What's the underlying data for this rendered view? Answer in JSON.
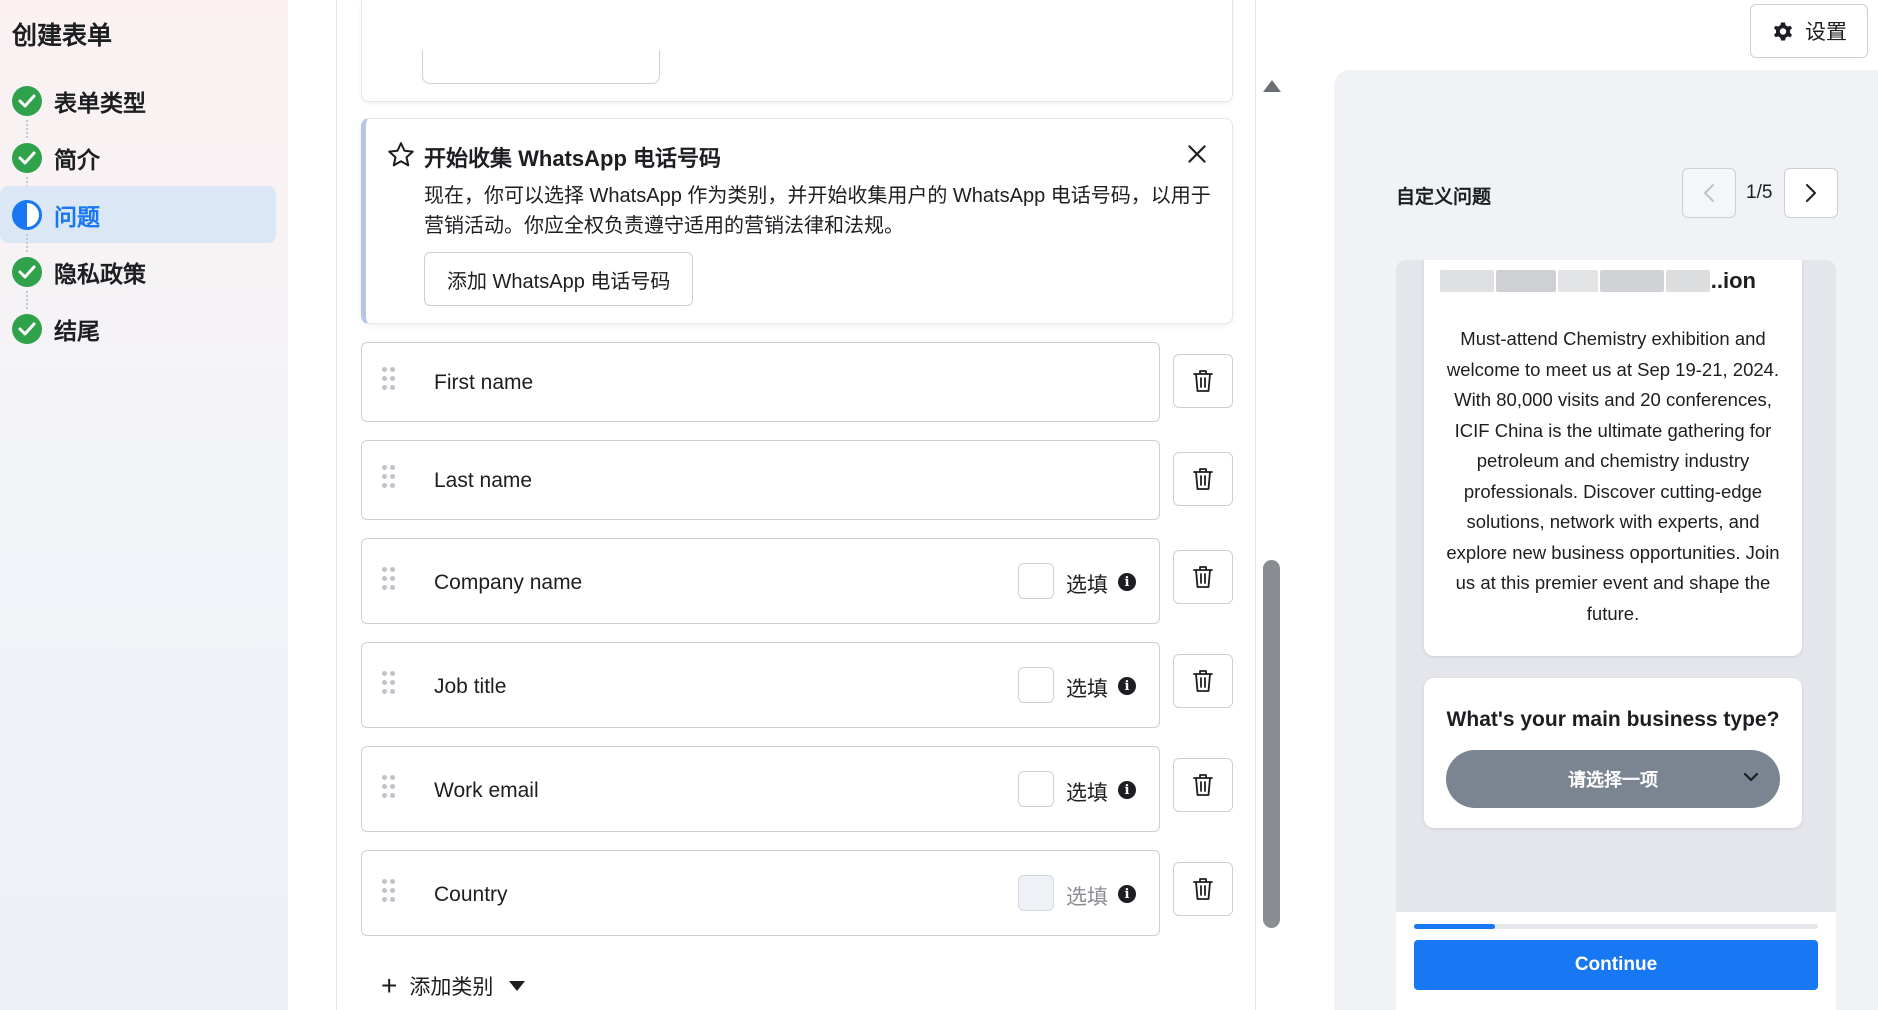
{
  "sidebar": {
    "title": "创建表单",
    "steps": [
      {
        "label": "表单类型",
        "state": "done"
      },
      {
        "label": "简介",
        "state": "done"
      },
      {
        "label": "问题",
        "state": "active"
      },
      {
        "label": "隐私政策",
        "state": "done"
      },
      {
        "label": "结尾",
        "state": "done"
      }
    ]
  },
  "header": {
    "settings_label": "设置"
  },
  "whatsapp_card": {
    "title": "开始收集 WhatsApp 电话号码",
    "body": "现在，你可以选择 WhatsApp 作为类别，并开始收集用户的 WhatsApp 电话号码，以用于营销活动。你应全权负责遵守适用的营销法律和法规。",
    "button_label": "添加 WhatsApp 电话号码"
  },
  "questions": [
    {
      "label": "First name",
      "optional_toggle": false
    },
    {
      "label": "Last name",
      "optional_toggle": false
    },
    {
      "label": "Company name",
      "optional_toggle": true,
      "optional_label": "选填",
      "disabled": false
    },
    {
      "label": "Job title",
      "optional_toggle": true,
      "optional_label": "选填",
      "disabled": false
    },
    {
      "label": "Work email",
      "optional_toggle": true,
      "optional_label": "选填",
      "disabled": false
    },
    {
      "label": "Country",
      "optional_toggle": true,
      "optional_label": "选填",
      "disabled": true
    }
  ],
  "add_category_label": "添加类别",
  "preview": {
    "title": "自定义问题",
    "page_indicator": "1/5",
    "intro_title_tail": "..ion",
    "intro_text": "Must-attend Chemistry exhibition and welcome to meet us at Sep 19-21, 2024. With 80,000 visits and 20 conferences, ICIF China is the ultimate gathering for petroleum and chemistry industry professionals. Discover cutting-edge solutions, network with experts, and explore new business opportunities. Join us at this premier event and shape the future.",
    "question_title": "What's your main business type?",
    "select_placeholder": "请选择一项",
    "progress_fraction": 0.2,
    "continue_label": "Continue"
  },
  "colors": {
    "accent": "#1877f2",
    "success": "#31a24c",
    "select_bg": "#7a8591"
  }
}
